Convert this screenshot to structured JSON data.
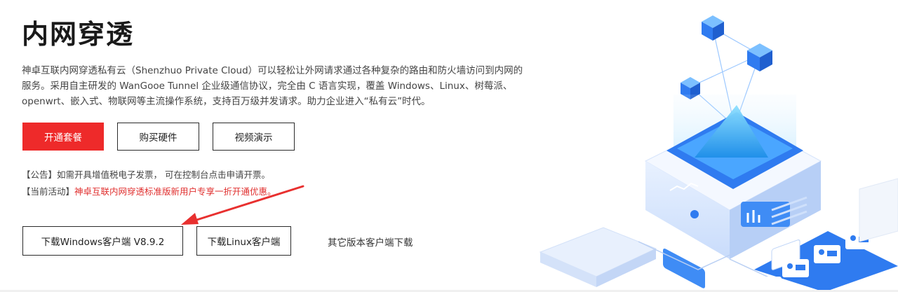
{
  "title": "内网穿透",
  "description": "神卓互联内网穿透私有云（Shenzhuo Private Cloud）可以轻松让外网请求通过各种复杂的路由和防火墙访问到内网的服务。采用自主研发的 WanGooe Tunnel 企业级通信协议，完全由 C 语言实现，覆盖 Windows、Linux、树莓派、openwrt、嵌入式、物联网等主流操作系统，支持百万级并发请求。助力企业进入“私有云”时代。",
  "buttons": {
    "subscribe": "开通套餐",
    "buy_hardware": "购买硬件",
    "video_demo": "视频演示"
  },
  "notices": {
    "announcement": "【公告】如需开具增值税电子发票， 可在控制台点击申请开票。",
    "activity_label": "【当前活动】",
    "activity_text": "神卓互联内网穿透标准版新用户专享一折开通优惠。"
  },
  "downloads": {
    "windows": "下载Windows客户端 V8.9.2",
    "linux": "下载Linux客户端",
    "other": "其它版本客户端下载"
  },
  "colors": {
    "primary": "#ee2a2a",
    "activity_text": "#e0302f",
    "arrow": "#e8302f",
    "illustration_blue": "#2f7bf0"
  }
}
